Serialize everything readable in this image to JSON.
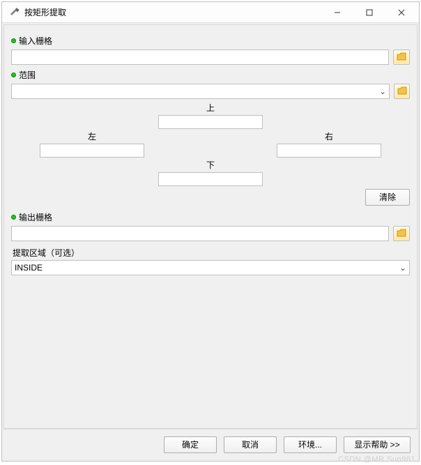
{
  "window": {
    "title": "按矩形提取"
  },
  "fields": {
    "input_raster_label": "输入栅格",
    "extent_label": "范围",
    "output_raster_label": "输出栅格",
    "optional_area_label": "提取区域（可选）"
  },
  "extent": {
    "top_label": "上",
    "left_label": "左",
    "right_label": "右",
    "bottom_label": "下",
    "clear_label": "清除"
  },
  "values": {
    "input_raster": "",
    "extent_selected": "",
    "top": "",
    "left": "",
    "right": "",
    "bottom": "",
    "output_raster": "",
    "area_selected": "INSIDE"
  },
  "buttons": {
    "ok": "确定",
    "cancel": "取消",
    "env": "环境...",
    "help": "显示帮助 >>"
  },
  "watermark": "CSDN @MR.Sun961"
}
